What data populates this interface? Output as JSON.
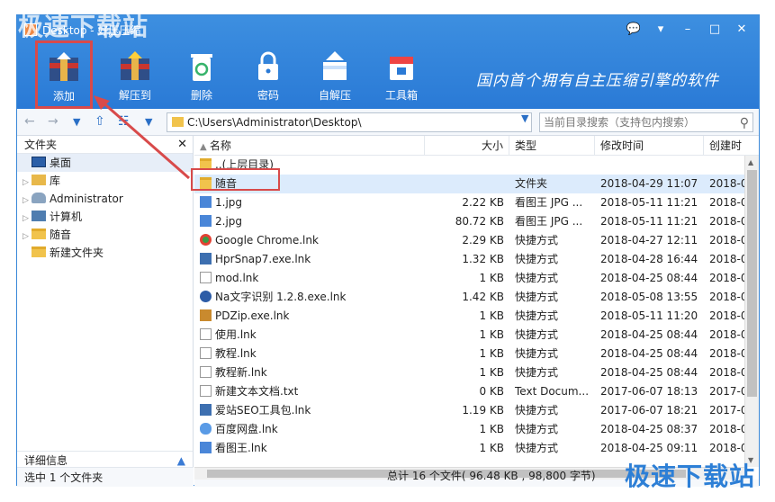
{
  "watermark": "极速下载站",
  "window": {
    "title": "Desktop - 好压压缩",
    "buttons": [
      "💬",
      "▾",
      "–",
      "□",
      "✕"
    ]
  },
  "toolbar": {
    "items": [
      {
        "label": "添加",
        "icon": "add-archive-icon"
      },
      {
        "label": "解压到",
        "icon": "extract-icon"
      },
      {
        "label": "删除",
        "icon": "recycle-icon"
      },
      {
        "label": "密码",
        "icon": "lock-icon"
      },
      {
        "label": "自解压",
        "icon": "self-extract-icon"
      },
      {
        "label": "工具箱",
        "icon": "toolbox-icon"
      }
    ],
    "slogan": "国内首个拥有自主压缩引擎的软件"
  },
  "address": {
    "path": "C:\\Users\\Administrator\\Desktop\\",
    "search_placeholder": "当前目录搜索（支持包内搜索）"
  },
  "sidebar": {
    "title": "文件夹",
    "items": [
      {
        "label": "桌面",
        "arrow": "",
        "icon": "desktop"
      },
      {
        "label": "库",
        "arrow": "▷",
        "icon": "lib"
      },
      {
        "label": "Administrator",
        "arrow": "▷",
        "icon": "user"
      },
      {
        "label": "计算机",
        "arrow": "▷",
        "icon": "pc"
      },
      {
        "label": "随音",
        "arrow": "▷",
        "icon": "folder"
      },
      {
        "label": "新建文件夹",
        "arrow": "",
        "icon": "folder"
      }
    ],
    "details": "详细信息"
  },
  "columns": {
    "name": "名称",
    "size": "大小",
    "type": "类型",
    "time": "修改时间",
    "create": "创建时"
  },
  "files": [
    {
      "name": "..(上层目录)",
      "size": "",
      "type": "",
      "time": "",
      "create": "",
      "icon": "folder"
    },
    {
      "name": "随音",
      "size": "",
      "type": "文件夹",
      "time": "2018-04-29 11:07",
      "create": "2018-0",
      "icon": "folder"
    },
    {
      "name": "1.jpg",
      "size": "2.22 KB",
      "type": "看图王 JPG ...",
      "time": "2018-05-11 11:21",
      "create": "2018-0",
      "icon": "jpg"
    },
    {
      "name": "2.jpg",
      "size": "80.72 KB",
      "type": "看图王 JPG ...",
      "time": "2018-05-11 11:21",
      "create": "2018-0",
      "icon": "jpg"
    },
    {
      "name": "Google Chrome.lnk",
      "size": "2.29 KB",
      "type": "快捷方式",
      "time": "2018-04-27 12:11",
      "create": "2018-0",
      "icon": "chrome"
    },
    {
      "name": "HprSnap7.exe.lnk",
      "size": "1.32 KB",
      "type": "快捷方式",
      "time": "2018-04-28 16:44",
      "create": "2018-0",
      "icon": "app"
    },
    {
      "name": "mod.lnk",
      "size": "1 KB",
      "type": "快捷方式",
      "time": "2018-04-25 08:44",
      "create": "2018-0",
      "icon": "doc"
    },
    {
      "name": "Na文字识别 1.2.8.exe.lnk",
      "size": "1.42 KB",
      "type": "快捷方式",
      "time": "2018-05-08 13:55",
      "create": "2018-0",
      "icon": "media"
    },
    {
      "name": "PDZip.exe.lnk",
      "size": "1 KB",
      "type": "快捷方式",
      "time": "2018-05-11 11:20",
      "create": "2018-0",
      "icon": "zip"
    },
    {
      "name": "使用.lnk",
      "size": "1 KB",
      "type": "快捷方式",
      "time": "2018-04-25 08:44",
      "create": "2018-0",
      "icon": "doc"
    },
    {
      "name": "教程.lnk",
      "size": "1 KB",
      "type": "快捷方式",
      "time": "2018-04-25 08:44",
      "create": "2018-0",
      "icon": "doc"
    },
    {
      "name": "教程新.lnk",
      "size": "1 KB",
      "type": "快捷方式",
      "time": "2018-04-25 08:44",
      "create": "2018-0",
      "icon": "doc"
    },
    {
      "name": "新建文本文档.txt",
      "size": "0 KB",
      "type": "Text Docum...",
      "time": "2017-06-07 18:13",
      "create": "2017-0",
      "icon": "doc"
    },
    {
      "name": "爱站SEO工具包.lnk",
      "size": "1.19 KB",
      "type": "快捷方式",
      "time": "2017-06-07 18:21",
      "create": "2017-0",
      "icon": "app"
    },
    {
      "name": "百度网盘.lnk",
      "size": "1 KB",
      "type": "快捷方式",
      "time": "2018-04-25 08:37",
      "create": "2018-0",
      "icon": "cloud"
    },
    {
      "name": "看图王.lnk",
      "size": "1 KB",
      "type": "快捷方式",
      "time": "2018-04-25 09:11",
      "create": "2018-0",
      "icon": "jpg"
    }
  ],
  "status": {
    "selected": "选中 1 个文件夹",
    "total": "总计 16 个文件( 96.48 KB , 98,800 字节)"
  }
}
